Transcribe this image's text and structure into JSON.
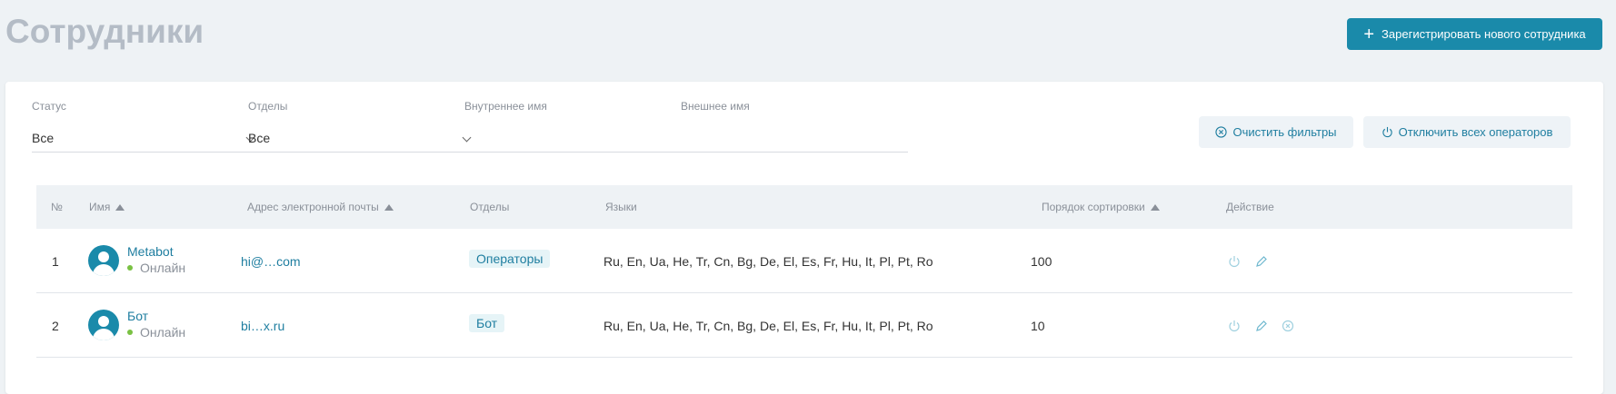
{
  "page": {
    "title": "Сотрудники",
    "register_button": "Зарегистрировать нового сотрудника"
  },
  "filters": {
    "status": {
      "label": "Статус",
      "value": "Все"
    },
    "departments": {
      "label": "Отделы",
      "value": "Все"
    },
    "internal_name": {
      "label": "Внутреннее имя",
      "value": ""
    },
    "external_name": {
      "label": "Внешнее имя",
      "value": ""
    },
    "clear_button": "Очистить фильтры",
    "disable_all_button": "Отключить всех операторов"
  },
  "table": {
    "headers": {
      "num": "№",
      "name": "Имя",
      "email": "Адрес электронной почты",
      "departments": "Отделы",
      "languages": "Языки",
      "sort_order": "Порядок сортировки",
      "action": "Действие"
    },
    "rows": [
      {
        "num": "1",
        "name": "Metabot",
        "status": "Онлайн",
        "email": "hi@…com",
        "department": "Операторы",
        "languages": "Ru, En, Ua, He, Tr, Cn, Bg, De, El, Es, Fr, Hu, It, Pl, Pt, Ro",
        "sort_order": "100"
      },
      {
        "num": "2",
        "name": "Бот",
        "status": "Онлайн",
        "email": "bi…x.ru",
        "department": "Бот",
        "languages": "Ru, En, Ua, He, Tr, Cn, Bg, De, El, Es, Fr, Hu, It, Pl, Pt, Ro",
        "sort_order": "10"
      }
    ]
  },
  "colors": {
    "accent": "#1a8aaa",
    "online": "#7ac143",
    "title": "#b4bcc6"
  },
  "icons": [
    "plus-icon",
    "clear-circle-icon",
    "power-icon",
    "chevron-down-icon",
    "sort-up-icon",
    "user-avatar-icon",
    "pencil-icon",
    "cancel-circle-icon"
  ]
}
